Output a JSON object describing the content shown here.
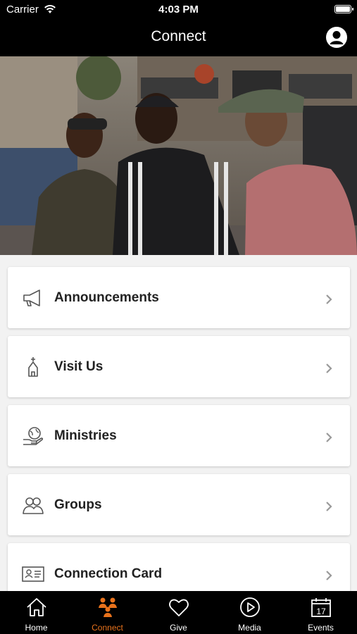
{
  "status_bar": {
    "carrier": "Carrier",
    "time": "4:03 PM"
  },
  "nav": {
    "title": "Connect"
  },
  "menu": [
    {
      "label": "Announcements",
      "icon": "megaphone-icon"
    },
    {
      "label": "Visit Us",
      "icon": "church-icon"
    },
    {
      "label": "Ministries",
      "icon": "globe-hand-icon"
    },
    {
      "label": "Groups",
      "icon": "people-icon"
    },
    {
      "label": "Connection Card",
      "icon": "id-card-icon"
    }
  ],
  "tabs": [
    {
      "label": "Home",
      "icon": "house-icon"
    },
    {
      "label": "Connect",
      "icon": "connect-people-icon",
      "active": true
    },
    {
      "label": "Give",
      "icon": "heart-icon"
    },
    {
      "label": "Media",
      "icon": "play-circle-icon"
    },
    {
      "label": "Events",
      "icon": "calendar-icon",
      "day": "17"
    }
  ],
  "colors": {
    "accent": "#e8721c",
    "bar": "#000000",
    "background": "#f2f2f2"
  }
}
